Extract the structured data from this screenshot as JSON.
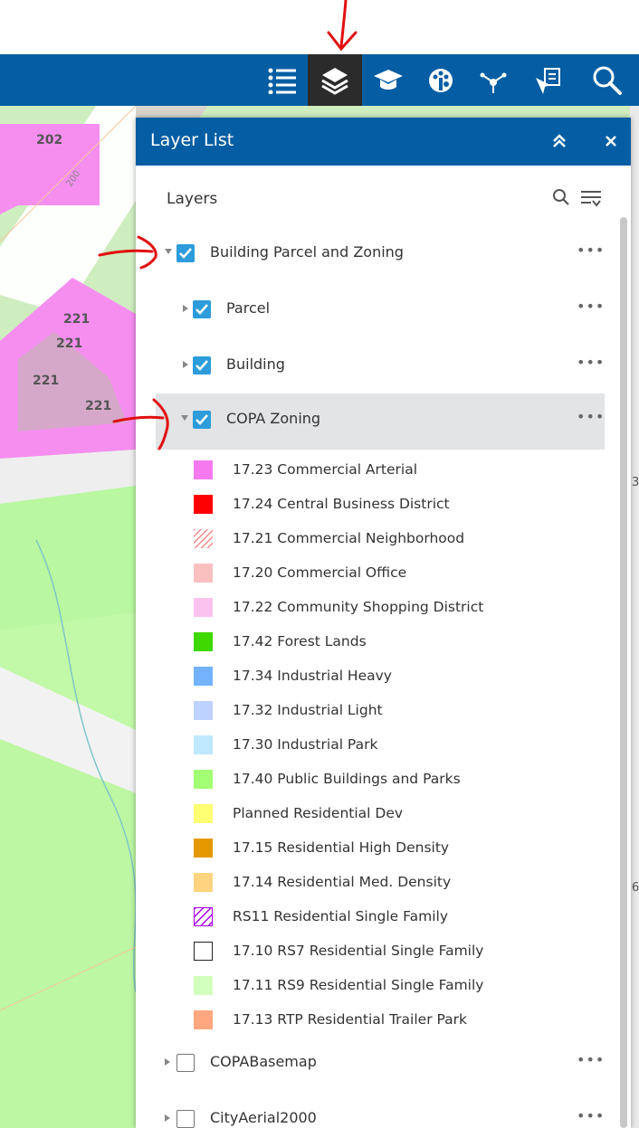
{
  "toolbar": {
    "icons": [
      "legend-icon",
      "layer-list-icon",
      "learn-icon",
      "palette-icon",
      "share-icon",
      "select-icon",
      "search-icon"
    ],
    "active_color": "#2b2b2b",
    "bar_color": "#055ea3"
  },
  "map": {
    "labels": [
      "202",
      "200",
      "221",
      "221",
      "221",
      "221",
      "3",
      "6"
    ]
  },
  "panel": {
    "title": "Layer List",
    "layers_label": "Layers",
    "layers": [
      {
        "label": "Building Parcel and Zoning",
        "checked": true,
        "expanded": true
      },
      {
        "label": "Parcel",
        "checked": true,
        "expanded": false
      },
      {
        "label": "Building",
        "checked": true,
        "expanded": false
      },
      {
        "label": "COPA Zoning",
        "checked": true,
        "expanded": true,
        "selected": true
      },
      {
        "label": "COPABasemap",
        "checked": false,
        "expanded": false
      },
      {
        "label": "CityAerial2000",
        "checked": false,
        "expanded": false
      }
    ],
    "more_label": "•••",
    "legend": [
      {
        "label": "17.23 Commercial Arterial",
        "color": "#f57af0",
        "pattern": "solid"
      },
      {
        "label": "17.24 Central Business District",
        "color": "#ff0000",
        "pattern": "solid"
      },
      {
        "label": "17.21 Commercial Neighborhood",
        "color": "#f58a8a",
        "pattern": "hatch"
      },
      {
        "label": "17.20 Commercial Office",
        "color": "#fac0c0",
        "pattern": "solid"
      },
      {
        "label": "17.22 Community Shopping District",
        "color": "#fcc2ee",
        "pattern": "solid"
      },
      {
        "label": "17.42 Forest Lands",
        "color": "#3fd800",
        "pattern": "solid"
      },
      {
        "label": "17.34 Industrial Heavy",
        "color": "#73b2ff",
        "pattern": "solid"
      },
      {
        "label": "17.32 Industrial Light",
        "color": "#bed2ff",
        "pattern": "solid"
      },
      {
        "label": "17.30 Industrial Park",
        "color": "#bee8ff",
        "pattern": "solid"
      },
      {
        "label": "17.40 Public Buildings and Parks",
        "color": "#a3ff73",
        "pattern": "solid"
      },
      {
        "label": "Planned Residential Dev",
        "color": "#ffff73",
        "pattern": "solid"
      },
      {
        "label": "17.15 Residential High Density",
        "color": "#e69800",
        "pattern": "solid"
      },
      {
        "label": "17.14 Residential Med. Density",
        "color": "#ffd37f",
        "pattern": "solid"
      },
      {
        "label": "RS11 Residential Single Family",
        "color": "#a800e6",
        "pattern": "hatch-outline"
      },
      {
        "label": "17.10 RS7 Residential Single Family",
        "color": "#222222",
        "pattern": "outline"
      },
      {
        "label": "17.11 RS9 Residential Single Family",
        "color": "#d3ffbe",
        "pattern": "solid"
      },
      {
        "label": "17.13 RTP Residential Trailer Park",
        "color": "#ffa77f",
        "pattern": "solid"
      }
    ]
  }
}
